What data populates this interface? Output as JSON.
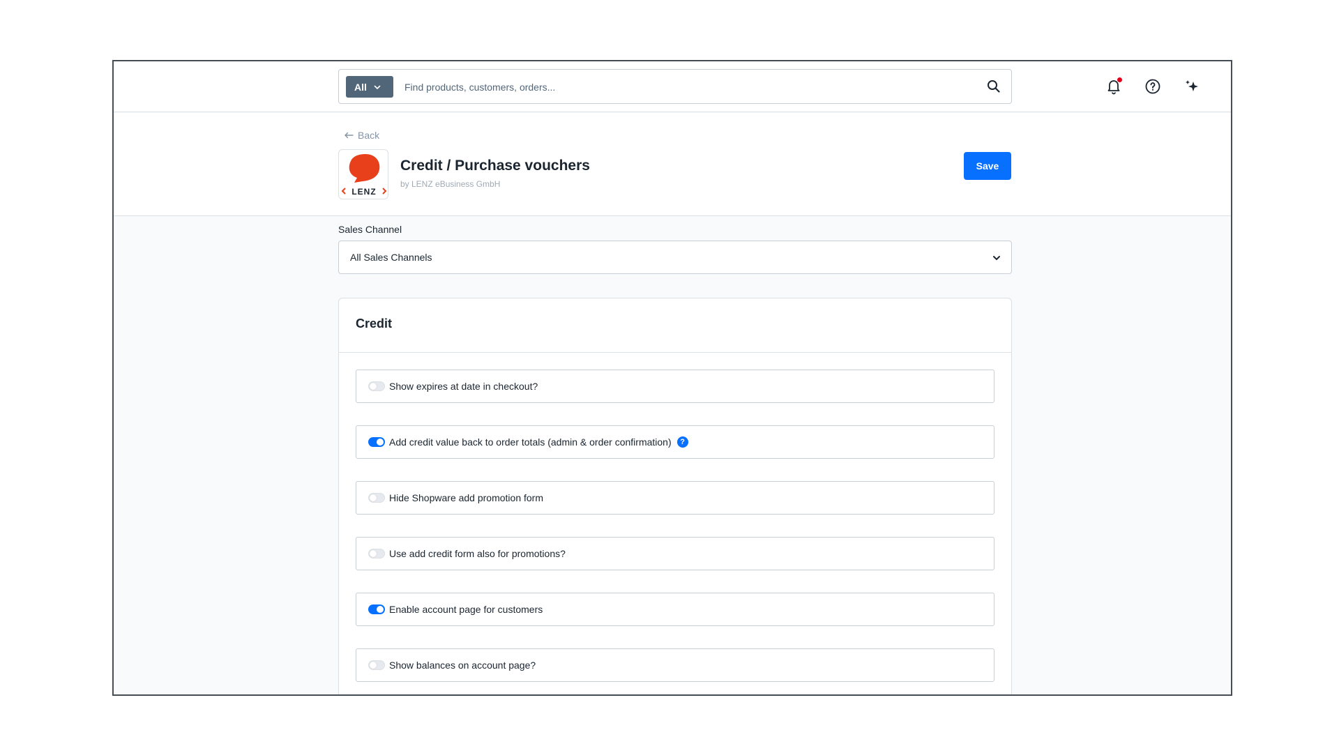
{
  "topbar": {
    "search_type_label": "All",
    "search_placeholder": "Find products, customers, orders...",
    "search_value": "",
    "icons": [
      "search-icon",
      "bell-icon",
      "help-icon",
      "sparkle-icon"
    ],
    "notification_dot_color": "#e3001b"
  },
  "header": {
    "back_label": "Back",
    "title": "Credit / Purchase vouchers",
    "subtitle": "by LENZ eBusiness GmbH",
    "logo_text": "LENZ",
    "save_label": "Save"
  },
  "sales_channel": {
    "label": "Sales Channel",
    "selected": "All Sales Channels"
  },
  "credit_card": {
    "title": "Credit",
    "options": [
      {
        "label": "Show expires at date in checkout?",
        "enabled": false
      },
      {
        "label": "Add credit value back to order totals (admin & order confirmation)",
        "enabled": true,
        "has_help": true
      },
      {
        "label": "Hide Shopware add promotion form",
        "enabled": false
      },
      {
        "label": "Use add credit form also for promotions?",
        "enabled": false
      },
      {
        "label": "Enable account page for customers",
        "enabled": true
      },
      {
        "label": "Show balances on account page?",
        "enabled": false
      }
    ],
    "help_glyph": "?"
  },
  "colors": {
    "primary": "#0870ff",
    "search_type_bg": "#52667a",
    "logo_red": "#e8401a"
  }
}
